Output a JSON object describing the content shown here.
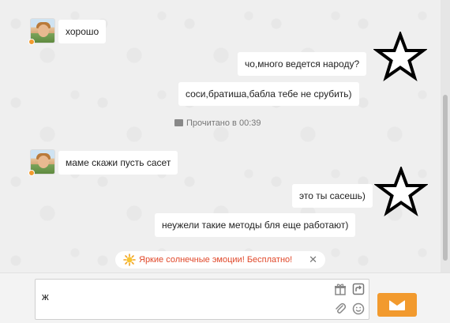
{
  "messages": [
    {
      "side": "in",
      "text": "хорошо"
    },
    {
      "side": "out",
      "text": "чо,много ведется народу?"
    },
    {
      "side": "out",
      "text": "соси,братиша,бабла тебе не срубить)"
    },
    {
      "side": "in",
      "text": "маме скажи пусть сасет"
    },
    {
      "side": "out",
      "text": "это ты сасешь)"
    },
    {
      "side": "out",
      "text": "неужели такие методы бля еще работают)"
    }
  ],
  "read_status": "Прочитано в 00:39",
  "promo": {
    "text": "Яркие солнечные эмоции! Бесплатно!",
    "close_label": "✕"
  },
  "composer": {
    "value": "ж"
  },
  "icons": {
    "gift": "gift-icon",
    "share": "share-icon",
    "attach": "paperclip-icon",
    "smiley": "smiley-icon",
    "send": "envelope-icon",
    "sun": "sun-icon"
  },
  "colors": {
    "accent": "#f29a2e",
    "promo_text": "#e0482a",
    "background": "#efefef"
  }
}
